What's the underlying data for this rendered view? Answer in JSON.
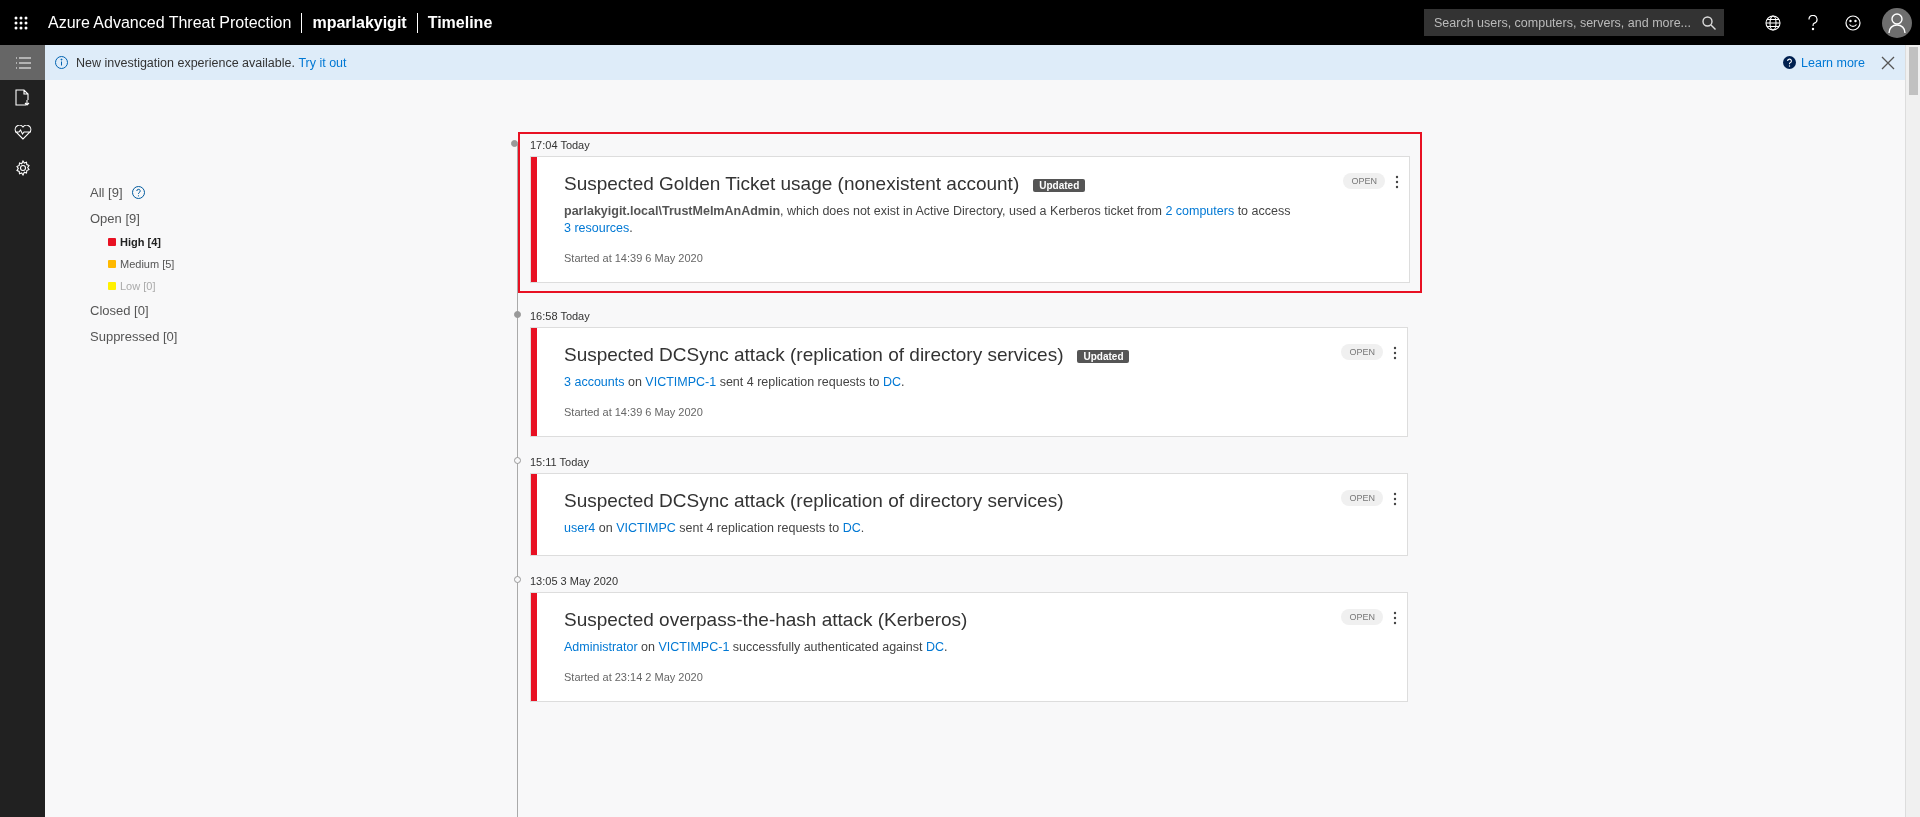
{
  "header": {
    "app_title": "Azure Advanced Threat Protection",
    "workspace": "mparlakyigit",
    "page": "Timeline",
    "search": {
      "placeholder": "Search users, computers, servers, and more..."
    }
  },
  "banner": {
    "message": "New investigation experience available.",
    "link": "Try it out",
    "learn_more": "Learn more"
  },
  "filters": [
    {
      "label": "All [9]",
      "kind": "status",
      "selected": false,
      "disabled": false,
      "help": true
    },
    {
      "label": "Open [9]",
      "kind": "status",
      "selected": false,
      "disabled": false,
      "help": false
    },
    {
      "label": "High [4]",
      "kind": "severity",
      "color": "#e81123",
      "selected": true,
      "disabled": false,
      "help": false
    },
    {
      "label": "Medium [5]",
      "kind": "severity",
      "color": "#ffb900",
      "selected": false,
      "disabled": false,
      "help": false
    },
    {
      "label": "Low [0]",
      "kind": "severity",
      "color": "#fff100",
      "selected": false,
      "disabled": true,
      "help": false
    },
    {
      "label": "Closed [0]",
      "kind": "status",
      "selected": false,
      "disabled": false,
      "help": false
    },
    {
      "label": "Suppressed [0]",
      "kind": "status",
      "selected": false,
      "disabled": false,
      "help": false
    }
  ],
  "alerts": [
    {
      "time": "17:04 Today",
      "new": true,
      "selected": true,
      "color": "#e81123",
      "title": "Suspected Golden Ticket usage (nonexistent account)",
      "badge": "Updated",
      "status": "OPEN",
      "description": [
        {
          "kind": "bold",
          "text": "parlakyigit.local\\TrustMeImAnAdmin"
        },
        {
          "kind": "text",
          "text": ", which does not exist in Active Directory, used a Kerberos ticket from "
        },
        {
          "kind": "link",
          "text": "2 computers"
        },
        {
          "kind": "text",
          "text": " to access "
        },
        {
          "kind": "break"
        },
        {
          "kind": "link",
          "text": "3 resources"
        },
        {
          "kind": "text",
          "text": "."
        }
      ],
      "started": "Started at 14:39 6 May 2020"
    },
    {
      "time": "16:58 Today",
      "new": true,
      "selected": false,
      "color": "#e81123",
      "title": "Suspected DCSync attack (replication of directory services)",
      "badge": "Updated",
      "status": "OPEN",
      "description": [
        {
          "kind": "link",
          "text": "3 accounts"
        },
        {
          "kind": "text",
          "text": " on "
        },
        {
          "kind": "link",
          "text": "VICTIMPC-1"
        },
        {
          "kind": "text",
          "text": " sent 4 replication requests to "
        },
        {
          "kind": "link",
          "text": "DC"
        },
        {
          "kind": "text",
          "text": "."
        }
      ],
      "started": "Started at 14:39 6 May 2020"
    },
    {
      "time": "15:11 Today",
      "new": false,
      "selected": false,
      "color": "#e81123",
      "title": "Suspected DCSync attack (replication of directory services)",
      "status": "OPEN",
      "description": [
        {
          "kind": "link",
          "text": "user4"
        },
        {
          "kind": "text",
          "text": " on "
        },
        {
          "kind": "link",
          "text": "VICTIMPC"
        },
        {
          "kind": "text",
          "text": " sent 4 replication requests to "
        },
        {
          "kind": "link",
          "text": "DC"
        },
        {
          "kind": "text",
          "text": "."
        }
      ]
    },
    {
      "time": "13:05 3 May 2020",
      "new": false,
      "selected": false,
      "color": "#e81123",
      "title": "Suspected overpass-the-hash attack (Kerberos)",
      "status": "OPEN",
      "description": [
        {
          "kind": "link",
          "text": "Administrator"
        },
        {
          "kind": "text",
          "text": " on "
        },
        {
          "kind": "link",
          "text": "VICTIMPC-1"
        },
        {
          "kind": "text",
          "text": " successfully authenticated against "
        },
        {
          "kind": "link",
          "text": "DC"
        },
        {
          "kind": "text",
          "text": "."
        }
      ],
      "started": "Started at 23:14 2 May 2020"
    }
  ]
}
